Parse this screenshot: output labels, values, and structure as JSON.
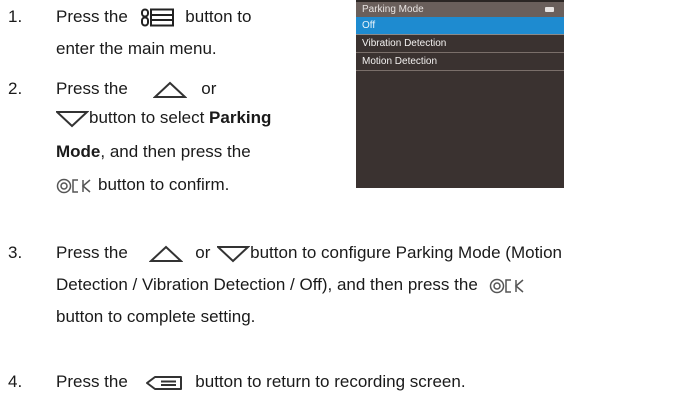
{
  "steps": [
    {
      "number": "1.",
      "lines": [
        {
          "before": "Press the",
          "icon": "menu-icon",
          "after": "button to"
        },
        {
          "text": "enter the main menu."
        }
      ]
    },
    {
      "number": "2.",
      "lines": [
        {
          "before": "Press the",
          "icon": "up-triangle-icon",
          "after": "or"
        },
        {
          "icon": "down-triangle-icon",
          "after_plain": "button to select ",
          "after_bold": "Parking"
        },
        {
          "bold": "Mode",
          "after": ", and then press the"
        },
        {
          "icon": "ok-icon",
          "after": "button to confirm."
        }
      ]
    },
    {
      "number": "3.",
      "lines": [
        {
          "before": "Press the",
          "icon": "up-triangle-icon",
          "mid": "or",
          "icon2": "down-triangle-icon",
          "after": "button to configure Parking Mode (Motion"
        },
        {
          "before": "Detection / Vibration Detection / Off), and then press the",
          "icon": "ok-icon"
        },
        {
          "text": "button to complete setting."
        }
      ]
    },
    {
      "number": "4.",
      "lines": [
        {
          "before": "Press the",
          "icon": "back-icon",
          "after": "button to return to recording screen."
        }
      ]
    }
  ],
  "device_screen": {
    "title": "Parking Mode",
    "items": [
      {
        "label": "Off",
        "selected": true
      },
      {
        "label": "Vibration Detection",
        "selected": false
      },
      {
        "label": "Motion Detection",
        "selected": false
      }
    ],
    "colors": {
      "background": "#3a3230",
      "title_bar": "#6a5f5b",
      "selected": "#1e8bd0"
    }
  }
}
